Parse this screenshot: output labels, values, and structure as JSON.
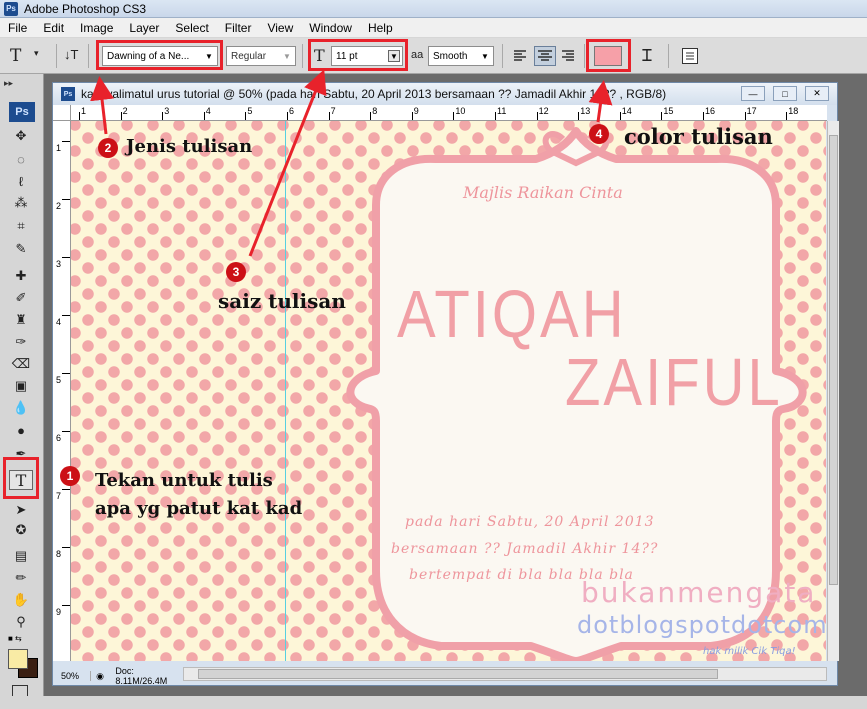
{
  "app": {
    "title": "Adobe Photoshop CS3",
    "logo": "Ps"
  },
  "menu": [
    "File",
    "Edit",
    "Image",
    "Layer",
    "Select",
    "Filter",
    "View",
    "Window",
    "Help"
  ],
  "options": {
    "tool_glyph": "T",
    "font_family": "Dawning of a Ne...",
    "font_style": "Regular",
    "font_size": "11 pt",
    "antialias_prefix": "aa",
    "antialias": "Smooth",
    "text_color": "#f6a0a8"
  },
  "document": {
    "icon": "Ps",
    "title": "kad walimatul urus tutorial @ 50% (pada hari Sabtu, 20 April 2013 bersamaan ?? Jamadil Akhir 14?? , RGB/8)",
    "zoom": "50%",
    "doc_size": "Doc: 8.11M/26.4M",
    "ruler_top": [
      "1",
      "2",
      "3",
      "4",
      "5",
      "6",
      "7",
      "8",
      "9",
      "10",
      "11",
      "12",
      "13",
      "14",
      "15",
      "16",
      "17",
      "18"
    ],
    "ruler_left": [
      "1",
      "2",
      "3",
      "4",
      "5",
      "6",
      "7",
      "8",
      "9"
    ]
  },
  "card": {
    "heading": "Majlis Raikan Cinta",
    "name1": "ATIQAH",
    "name2": "ZAIFUL",
    "line1": "pada hari Sabtu, 20 April 2013",
    "line2": "bersamaan ?? Jamadil Akhir 14??",
    "line3": "bertempat di bla bla bla bla",
    "watermark1": "bukanmengata",
    "watermark2": "dotblogspotdotcom",
    "watermark3": "hak milik Cik Tiqa!"
  },
  "annotations": {
    "n1": "1",
    "t1a": "Tekan untuk tulis",
    "t1b": "apa yg patut kat kad",
    "n2": "2",
    "t2": "Jenis tulisan",
    "n3": "3",
    "t3": "saiz tulisan",
    "n4": "4",
    "t4": "color tulisan"
  },
  "colors": {
    "accent_red": "#e8222b",
    "dot_pink": "#f2a7a8",
    "paper": "#fdf6d8",
    "frame_pink": "#f0a0a8"
  }
}
